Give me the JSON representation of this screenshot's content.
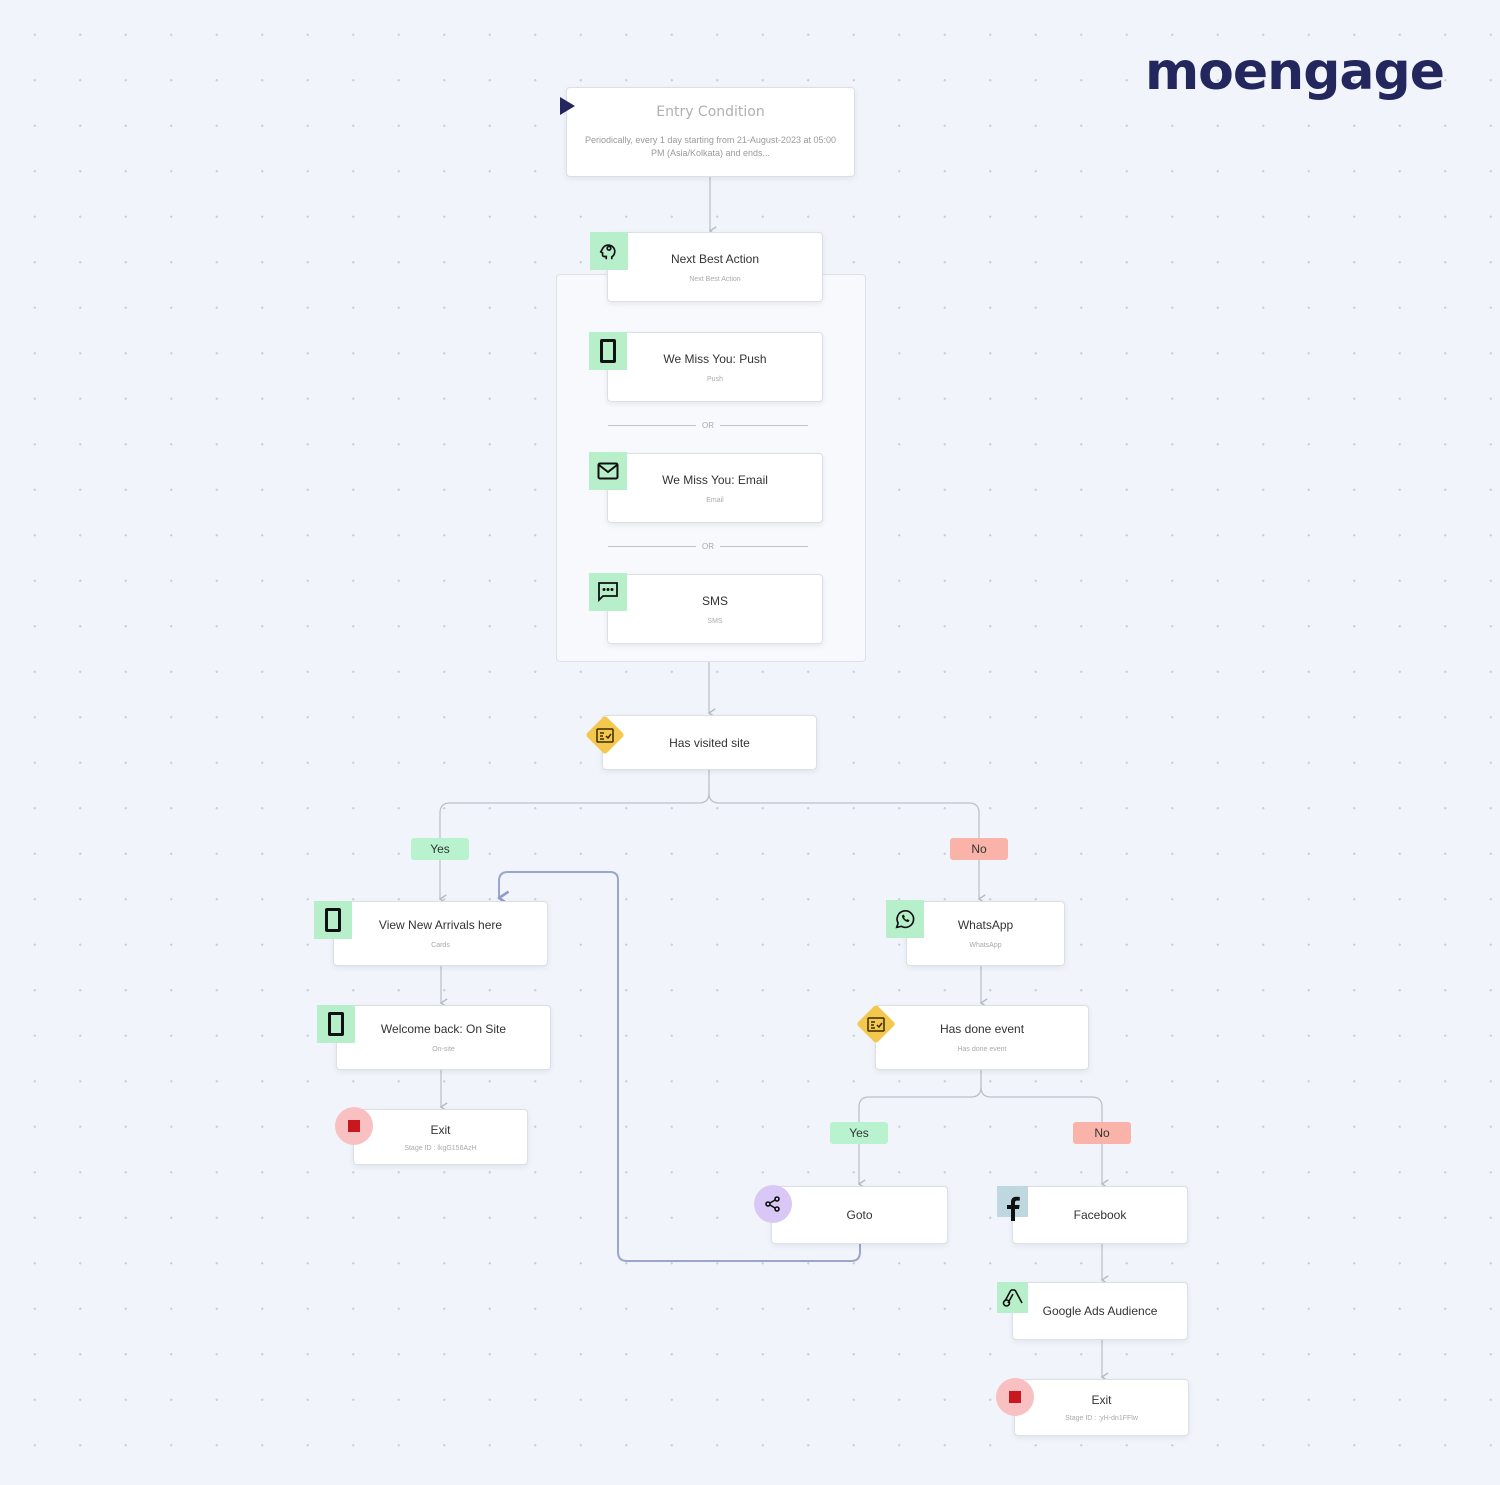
{
  "brand": {
    "logo_text": "moengage",
    "color": "#23275e"
  },
  "entry": {
    "title": "Entry Condition",
    "description": "Periodically, every 1 day starting from 21-August-2023 at 05:00 PM (Asia/Kolkata) and ends..."
  },
  "nba_group": {
    "header": {
      "title": "Next Best Action",
      "subtitle": "Next Best Action",
      "icon": "head-gear-icon"
    },
    "or_label": "OR",
    "items": [
      {
        "title": "We Miss You: Push",
        "subtitle": "Push",
        "icon": "mobile-icon"
      },
      {
        "title": "We Miss You: Email",
        "subtitle": "Email",
        "icon": "mail-icon"
      },
      {
        "title": "SMS",
        "subtitle": "SMS",
        "icon": "chat-icon"
      }
    ]
  },
  "condition_1": {
    "title": "Has visited site",
    "icon": "condition-checklist-icon"
  },
  "branch_labels": {
    "yes": "Yes",
    "no": "No"
  },
  "yes_branch": [
    {
      "title": "View New Arrivals here",
      "subtitle": "Cards",
      "icon": "mobile-icon"
    },
    {
      "title": "Welcome back: On Site",
      "subtitle": "On-site",
      "icon": "mobile-icon"
    },
    {
      "title": "Exit",
      "subtitle": "Stage ID : lkgG156AzH",
      "icon": "stop-icon"
    }
  ],
  "no_branch": {
    "whatsapp": {
      "title": "WhatsApp",
      "subtitle": "WhatsApp",
      "icon": "whatsapp-icon"
    },
    "condition_2": {
      "title": "Has done event",
      "subtitle": "Has done event",
      "icon": "condition-checklist-icon"
    },
    "yes_path": {
      "title": "Goto",
      "icon": "share-icon"
    },
    "no_path": [
      {
        "title": "Facebook",
        "icon": "facebook-icon"
      },
      {
        "title": "Google Ads Audience",
        "icon": "google-ads-icon"
      },
      {
        "title": "Exit",
        "subtitle": "Stage ID : :yH-dn1FFlw",
        "icon": "stop-icon"
      }
    ]
  },
  "colors": {
    "channel_icon_bg": "#b7efcb",
    "condition_icon_bg": "#f4c84f",
    "yes_pill": "#b9f2cf",
    "no_pill": "#f9b3a8",
    "exit_icon_bg": "#f8c0c0",
    "goto_icon_bg": "#d9c8f6",
    "goto_loop_line": "#9aa6cc"
  }
}
